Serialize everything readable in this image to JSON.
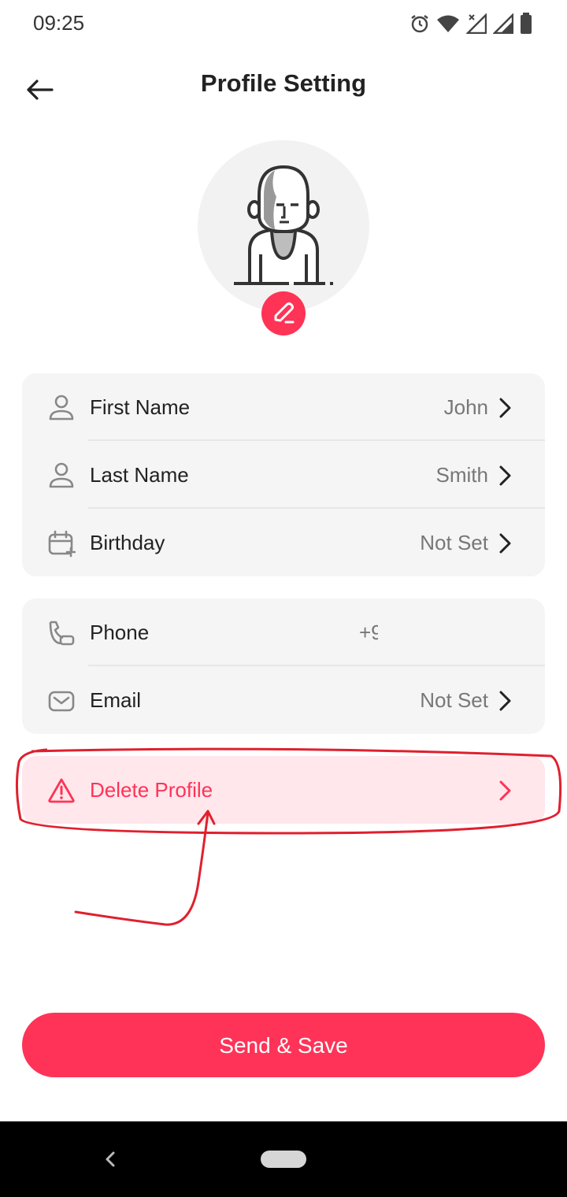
{
  "status_bar": {
    "time": "09:25"
  },
  "header": {
    "title": "Profile Setting"
  },
  "personal_card": [
    {
      "label": "First Name",
      "value": "John"
    },
    {
      "label": "Last Name",
      "value": "Smith"
    },
    {
      "label": "Birthday",
      "value": "Not Set"
    }
  ],
  "contact_card": [
    {
      "label": "Phone",
      "value": "+9"
    },
    {
      "label": "Email",
      "value": "Not Set"
    }
  ],
  "delete": {
    "label": "Delete Profile"
  },
  "save_button": {
    "label": "Send & Save"
  },
  "icons": {
    "back": "arrow-left-icon",
    "avatar": "person-illustration",
    "edit": "pencil-icon",
    "first_name": "user-icon",
    "last_name": "user-icon",
    "birthday": "calendar-add-icon",
    "phone": "phone-icon",
    "email": "mail-icon",
    "delete": "warning-icon",
    "chevron": "chevron-right-icon"
  },
  "colors": {
    "accent": "#ff3355",
    "card_bg": "#f5f5f5",
    "danger_bg": "#ffe7ec",
    "annotation": "#e0202e"
  }
}
